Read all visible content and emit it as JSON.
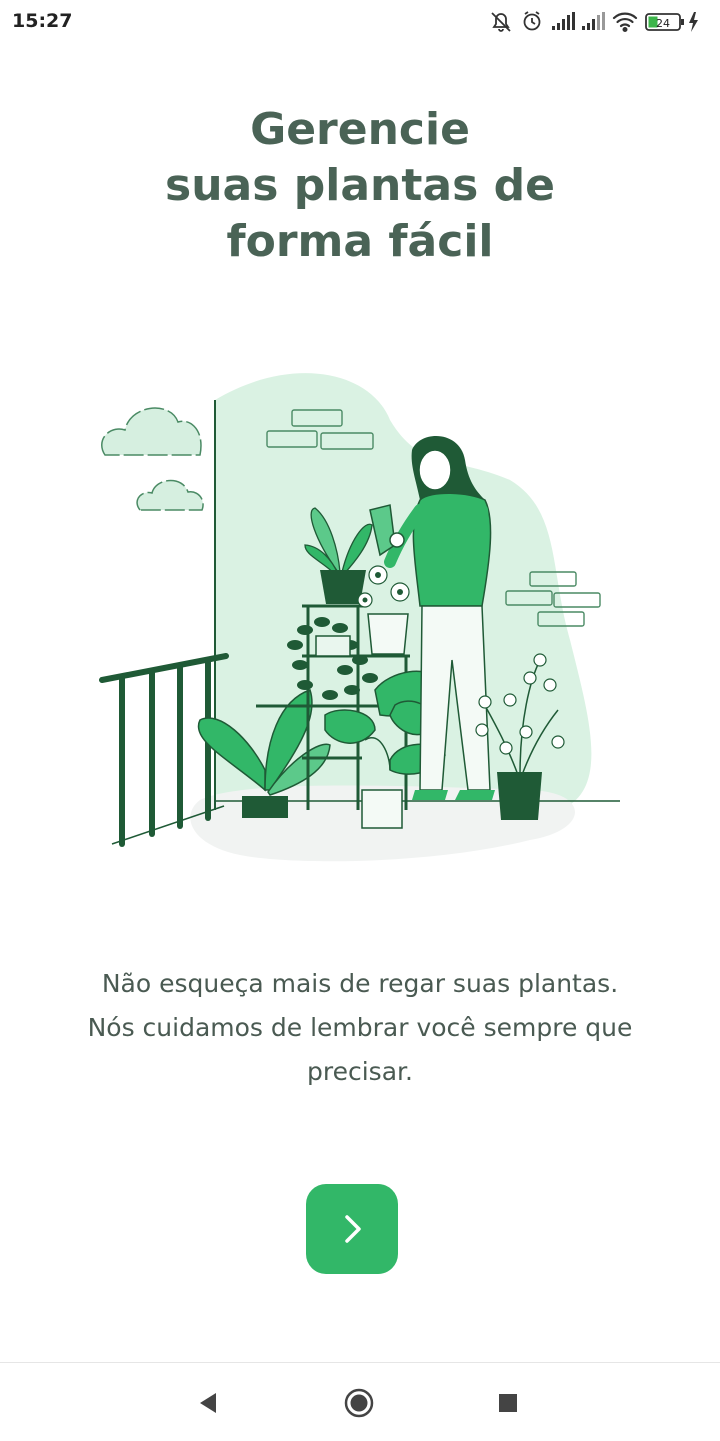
{
  "status_bar": {
    "time": "15:27",
    "battery_level": "24",
    "icons": [
      "bell-off-icon",
      "alarm-icon",
      "signal-icon",
      "signal-icon",
      "wifi-icon",
      "battery-icon",
      "charging-icon"
    ]
  },
  "welcome": {
    "title_lines": [
      "Gerencie",
      "suas plantas de",
      "forma fácil"
    ],
    "description_lines": [
      "Não esqueça mais de regar suas plantas.",
      "Nós cuidamos de lembrar você sempre que",
      "precisar."
    ],
    "next_icon": "chevron-right-icon"
  },
  "nav_bar": {
    "icons": [
      "back-icon",
      "home-icon",
      "recents-icon"
    ]
  },
  "colors": {
    "primary": "#32b768",
    "title": "#4a6356",
    "text": "#4a5a52",
    "illustration_bg": "#daf2e3",
    "dark_green": "#1f5a36"
  }
}
